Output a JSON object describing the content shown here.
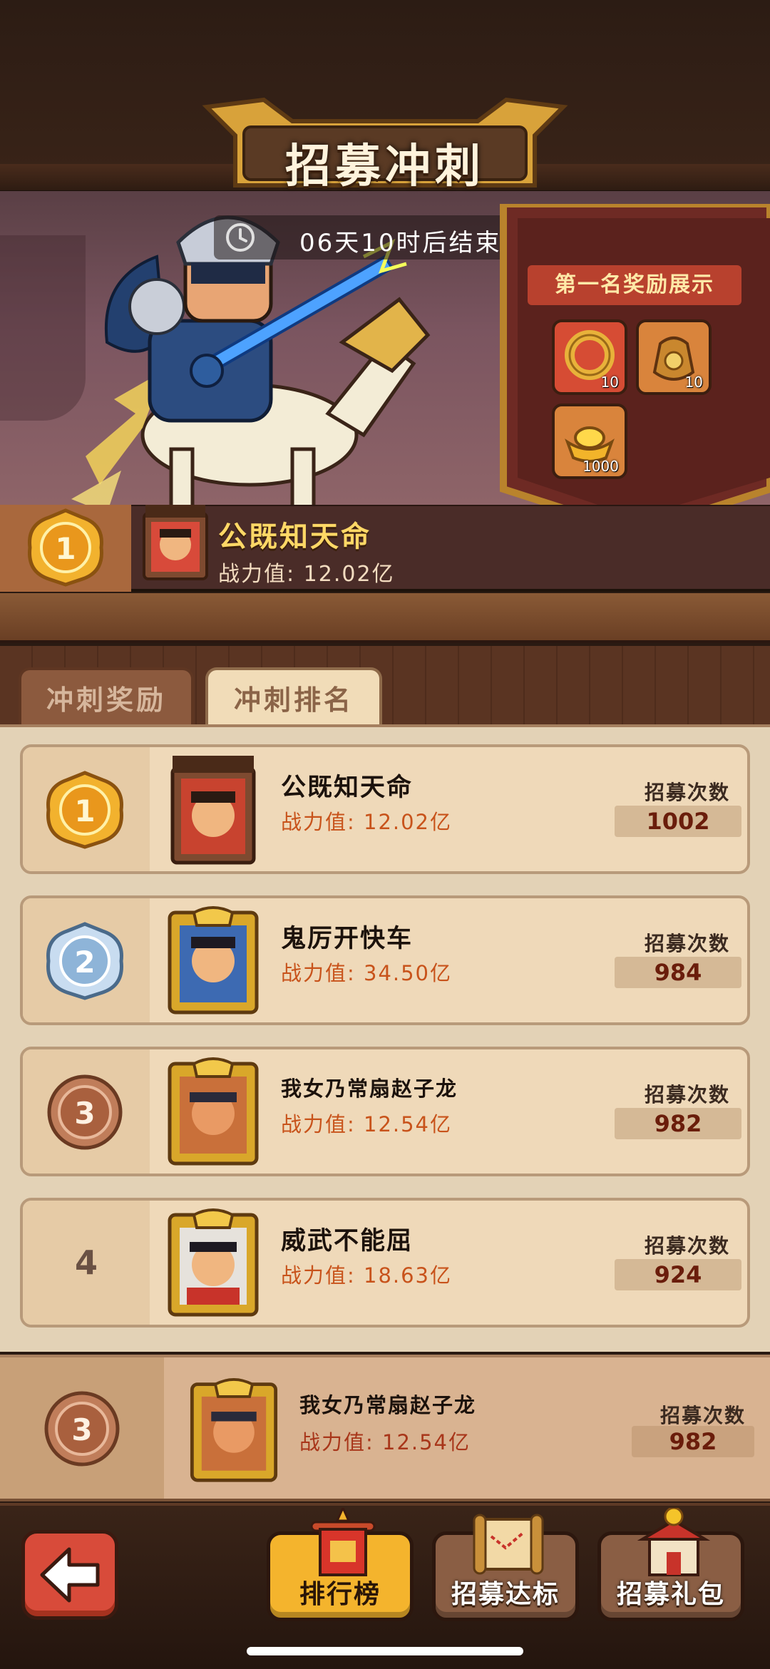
{
  "header": {
    "title": "招募冲刺",
    "timer": "06天10时后结束"
  },
  "first_reward": {
    "title": "第一名奖励展示",
    "items": [
      {
        "icon": "jade-ring-icon",
        "count": "10"
      },
      {
        "icon": "coin-bag-icon",
        "count": "10"
      },
      {
        "icon": "gold-ingot-icon",
        "count": "1000"
      }
    ]
  },
  "top_player": {
    "rank": "1",
    "name": "公既知天命",
    "power": "战力值: 12.02亿"
  },
  "tabs": [
    {
      "label": "冲刺奖励"
    },
    {
      "label": "冲刺排名"
    }
  ],
  "rankings": [
    {
      "rank": "1",
      "name": "公既知天命",
      "power": "战力值: 12.02亿",
      "count_label": "招募次数",
      "count": "1002"
    },
    {
      "rank": "2",
      "name": "鬼厉开快车",
      "power": "战力值: 34.50亿",
      "count_label": "招募次数",
      "count": "984"
    },
    {
      "rank": "3",
      "name": "我女乃常扇赵子龙",
      "power": "战力值: 12.54亿",
      "count_label": "招募次数",
      "count": "982"
    },
    {
      "rank": "4",
      "name": "威武不能屈",
      "power": "战力值: 18.63亿",
      "count_label": "招募次数",
      "count": "924"
    }
  ],
  "self": {
    "rank": "3",
    "name": "我女乃常扇赵子龙",
    "power": "战力值: 12.54亿",
    "count_label": "招募次数",
    "count": "982"
  },
  "nav": {
    "back": "back-arrow-icon",
    "items": [
      {
        "label": "排行榜"
      },
      {
        "label": "招募达标"
      },
      {
        "label": "招募礼包"
      }
    ]
  },
  "colors": {
    "gold": "#f4b42d",
    "medal_gold": "#e9a21c",
    "medal_silver": "#a9c8e6",
    "medal_bronze": "#b26a4a",
    "power_text": "#c8531b"
  }
}
